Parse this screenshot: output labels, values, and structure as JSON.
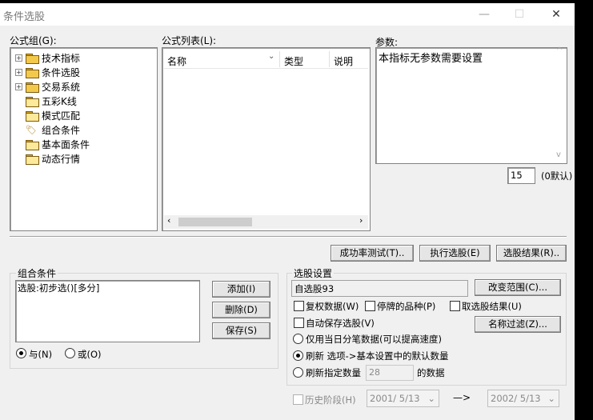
{
  "window": {
    "title": "条件选股",
    "minimize": "—",
    "maximize": "☐",
    "close": "✕"
  },
  "left": {
    "label": "公式组(G):",
    "tree": [
      {
        "label": "技术指标",
        "expandable": true,
        "icon": "folder-icon"
      },
      {
        "label": "条件选股",
        "expandable": true,
        "icon": "folder-icon"
      },
      {
        "label": "交易系统",
        "expandable": true,
        "icon": "folder-icon"
      },
      {
        "label": "五彩K线",
        "expandable": false,
        "icon": "folder-icon"
      },
      {
        "label": "模式匹配",
        "expandable": false,
        "icon": "folder-icon"
      },
      {
        "label": "组合条件",
        "expandable": false,
        "icon": "tag-icon"
      },
      {
        "label": "基本面条件",
        "expandable": false,
        "icon": "folder-icon"
      },
      {
        "label": "动态行情",
        "expandable": false,
        "icon": "folder-icon"
      }
    ]
  },
  "formula_list": {
    "label": "公式列表(L):",
    "columns": [
      "名称",
      "类型",
      "说明"
    ]
  },
  "params": {
    "label": "参数:",
    "text": "本指标无参数需要设置",
    "count_value": "15",
    "count_hint": "(0默认)"
  },
  "actions": {
    "success_test": "成功率测试(T)..",
    "run_select": "执行选股(E)",
    "select_result": "选股结果(R).."
  },
  "combo": {
    "title": "组合条件",
    "items": [
      "选股:初步选()[多分]"
    ],
    "add": "添加(I)",
    "delete": "删除(D)",
    "save": "保存(S)",
    "and_label": "与(N)",
    "or_label": "或(O)",
    "mode": "and"
  },
  "settings": {
    "title": "选股设置",
    "block_name": "自选股93",
    "change_range": "改变范围(C)...",
    "name_filter": "名称过滤(Z)...",
    "checks": {
      "restore_right": "复权数据(W)",
      "suspended": "停牌的品种(P)",
      "invert": "取选股结果(U)",
      "autosave": "自动保存选股(V)"
    },
    "radios": {
      "today_only": "仅用当日分笔数据(可以提高速度)",
      "refresh_default": "刷新 选项->基本设置中的默认数量",
      "refresh_n": "刷新指定数量",
      "refresh_n_suffix": "的数据",
      "selected": "refresh_default"
    },
    "refresh_count": "28",
    "history": "历史阶段(H)",
    "date_from": "2001/ 5/13",
    "date_to": "2002/ 5/13",
    "arrow": "—>"
  }
}
